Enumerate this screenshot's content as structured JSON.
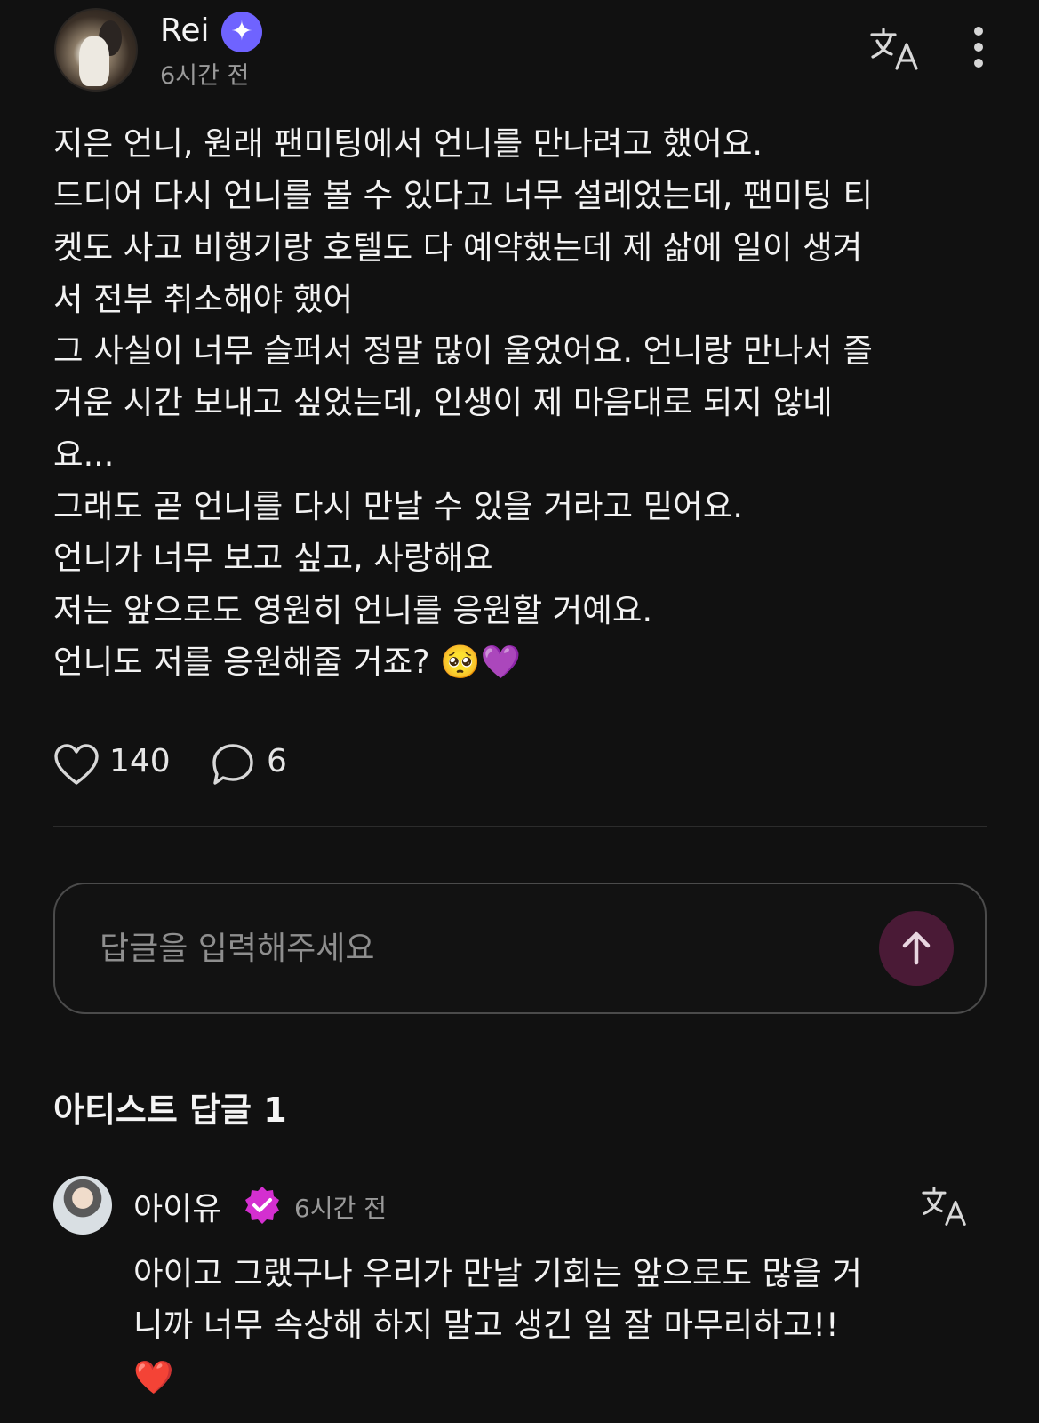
{
  "post": {
    "author": {
      "name": "Rei",
      "badge_icon": "sparkle-verified-icon",
      "badge_color": "#6f63ff",
      "time": "6시간 전"
    },
    "body_lines": [
      "지은 언니, 원래 팬미팅에서 언니를 만나려고 했어요.",
      "드디어 다시 언니를 볼 수 있다고 너무 설레었는데, 팬미팅 티",
      "켓도 사고 비행기랑 호텔도 다 예약했는데 제 삶에 일이 생겨",
      "서 전부 취소해야 했어",
      "그 사실이 너무 슬퍼서 정말 많이 울었어요. 언니랑 만나서 즐",
      "거운 시간 보내고 싶었는데, 인생이 제 마음대로 되지 않네",
      "요...",
      "그래도 곧 언니를 다시 만날 수 있을 거라고 믿어요.",
      "언니가 너무 보고 싶고, 사랑해요",
      "저는 앞으로도 영원히 언니를 응원할 거예요.",
      "언니도 저를 응원해줄 거죠? 🥺💜"
    ],
    "likes": "140",
    "comments": "6"
  },
  "reply_input": {
    "placeholder": "답글을 입력해주세요",
    "send_color": "#4a1a36"
  },
  "artist_replies": {
    "title": "아티스트 답글 1",
    "items": [
      {
        "name": "아이유",
        "badge_color": "#d42fd0",
        "time": "6시간 전",
        "lines": [
          "아이고 그랬구나 우리가 만날 기회는 앞으로도 많을 거",
          "니까 너무 속상해 하지 말고 생긴 일 잘 마무리하고!!",
          "❤️"
        ]
      }
    ]
  }
}
